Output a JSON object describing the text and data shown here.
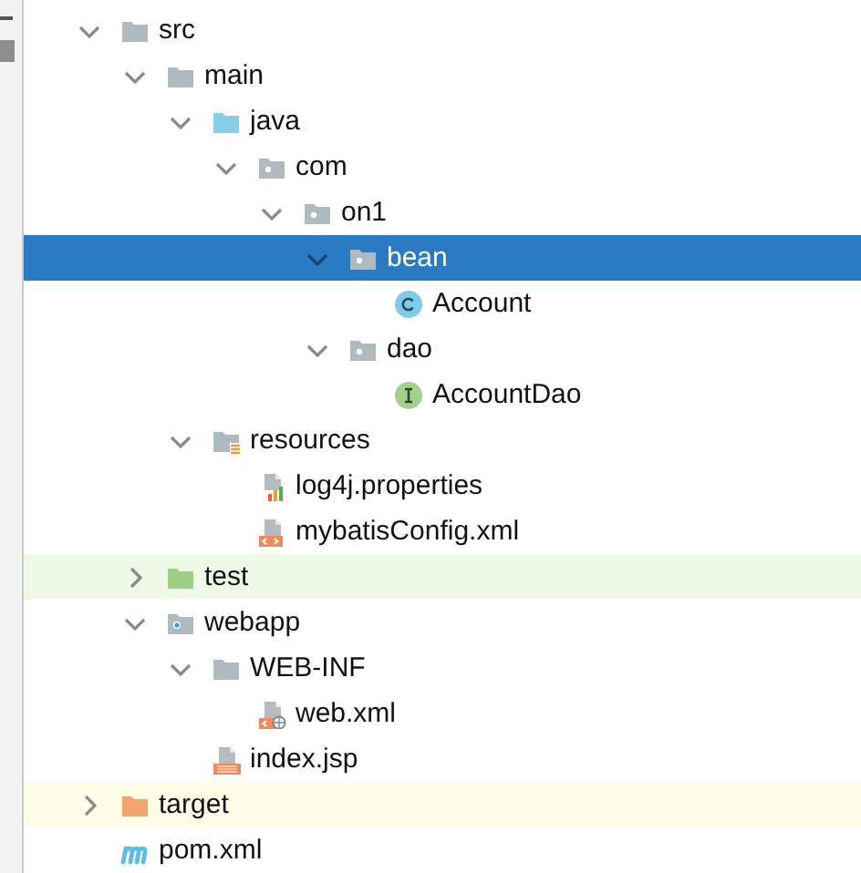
{
  "tree": [
    {
      "label": "src",
      "kind": "folder",
      "expanded": true,
      "selected": false,
      "children": [
        {
          "label": "main",
          "kind": "folder",
          "expanded": true,
          "selected": false,
          "children": [
            {
              "label": "java",
              "kind": "source-root",
              "expanded": true,
              "selected": false,
              "children": [
                {
                  "label": "com",
                  "kind": "package",
                  "expanded": true,
                  "selected": false,
                  "children": [
                    {
                      "label": "on1",
                      "kind": "package",
                      "expanded": true,
                      "selected": false,
                      "children": [
                        {
                          "label": "bean",
                          "kind": "package",
                          "expanded": true,
                          "selected": true,
                          "children": [
                            {
                              "label": "Account",
                              "kind": "class",
                              "selected": false
                            }
                          ]
                        },
                        {
                          "label": "dao",
                          "kind": "package",
                          "expanded": true,
                          "selected": false,
                          "children": [
                            {
                              "label": "AccountDao",
                              "kind": "interface",
                              "selected": false
                            }
                          ]
                        }
                      ]
                    }
                  ]
                }
              ]
            },
            {
              "label": "resources",
              "kind": "resources-root",
              "expanded": true,
              "selected": false,
              "children": [
                {
                  "label": "log4j.properties",
                  "kind": "properties",
                  "selected": false
                },
                {
                  "label": "mybatisConfig.xml",
                  "kind": "xml",
                  "selected": false
                }
              ]
            }
          ]
        },
        {
          "label": "test",
          "kind": "test-root",
          "expanded": false,
          "selected": false,
          "color": "#eef8e6"
        },
        {
          "label": "webapp",
          "kind": "web-root",
          "expanded": true,
          "selected": false,
          "children": [
            {
              "label": "WEB-INF",
              "kind": "folder",
              "expanded": true,
              "selected": false,
              "children": [
                {
                  "label": "web.xml",
                  "kind": "web-xml",
                  "selected": false
                }
              ]
            },
            {
              "label": "index.jsp",
              "kind": "jsp",
              "selected": false
            }
          ]
        }
      ]
    },
    {
      "label": "target",
      "kind": "excluded",
      "expanded": false,
      "selected": false,
      "color": "#fdfde8"
    },
    {
      "label": "pom.xml",
      "kind": "maven",
      "selected": false
    }
  ]
}
